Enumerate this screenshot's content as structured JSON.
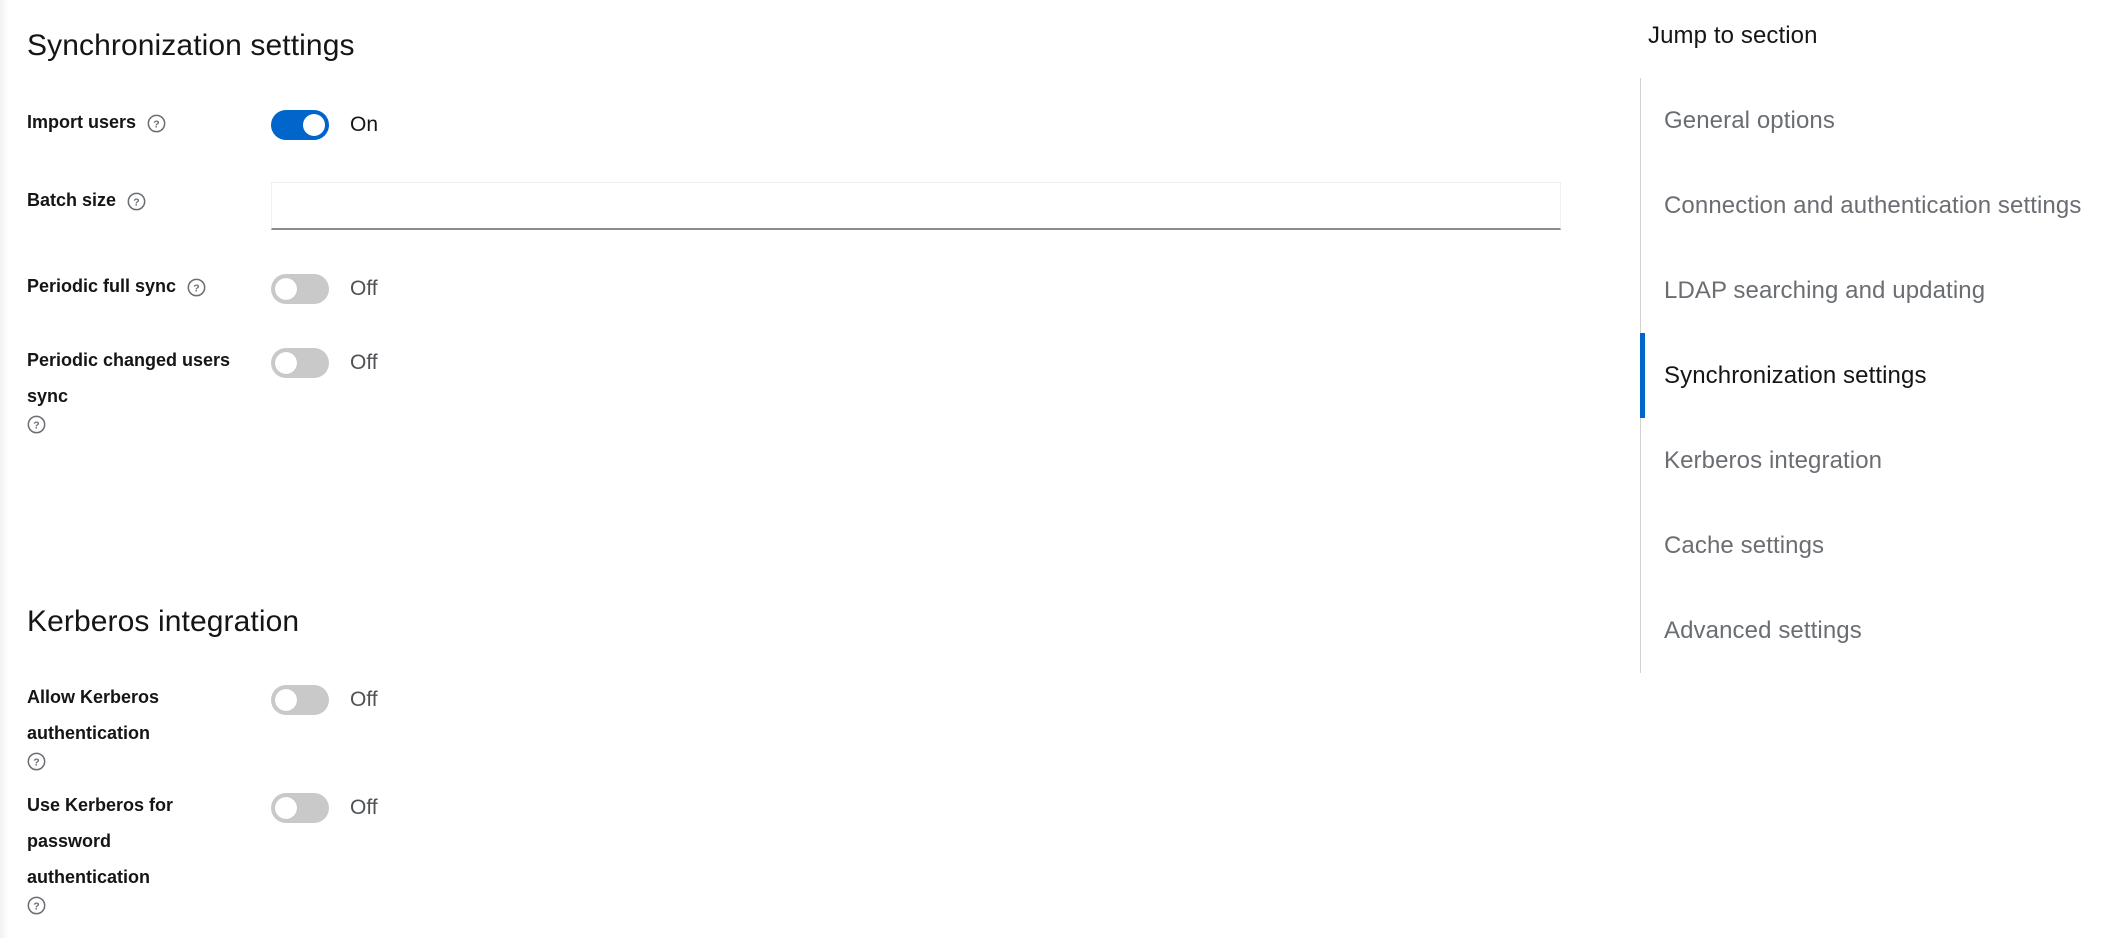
{
  "main": {
    "sections": [
      {
        "id": "synchronization-settings",
        "title": "Synchronization settings",
        "fields": [
          {
            "id": "import-users",
            "label": "Import users",
            "help_icon": "help-circle-icon",
            "control": "toggle",
            "state": "On",
            "on": true
          },
          {
            "id": "batch-size",
            "label": "Batch size",
            "help_icon": "help-circle-icon",
            "control": "text-input",
            "value": "",
            "placeholder": ""
          },
          {
            "id": "periodic-full-sync",
            "label": "Periodic full sync",
            "help_icon": "help-circle-icon",
            "control": "toggle",
            "state": "Off",
            "on": false
          },
          {
            "id": "periodic-changed-users-sync",
            "label": "Periodic changed users sync",
            "help_icon": "help-circle-icon",
            "control": "toggle",
            "state": "Off",
            "on": false
          }
        ]
      },
      {
        "id": "kerberos-integration",
        "title": "Kerberos integration",
        "fields": [
          {
            "id": "allow-kerberos-authentication",
            "label": "Allow Kerberos authentication",
            "help_icon": "help-circle-icon",
            "control": "toggle",
            "state": "Off",
            "on": false
          },
          {
            "id": "use-kerberos-for-password-authentication",
            "label": "Use Kerberos for password authentication",
            "help_icon": "help-circle-icon",
            "control": "toggle",
            "state": "Off",
            "on": false
          }
        ]
      }
    ]
  },
  "jump_nav": {
    "title": "Jump to section",
    "items": [
      {
        "label": "General options",
        "active": false
      },
      {
        "label": "Connection and authentication settings",
        "active": false
      },
      {
        "label": "LDAP searching and updating",
        "active": false
      },
      {
        "label": "Synchronization settings",
        "active": true
      },
      {
        "label": "Kerberos integration",
        "active": false
      },
      {
        "label": "Cache settings",
        "active": false
      },
      {
        "label": "Advanced settings",
        "active": false
      }
    ]
  },
  "colors": {
    "accent_blue": "#0066cc",
    "toggle_off_gray": "#c9c9c9",
    "nav_link_gray": "#6a6e73",
    "text_primary": "#151515",
    "divider": "#d2d2d2",
    "input_underline": "#8a8d90"
  }
}
